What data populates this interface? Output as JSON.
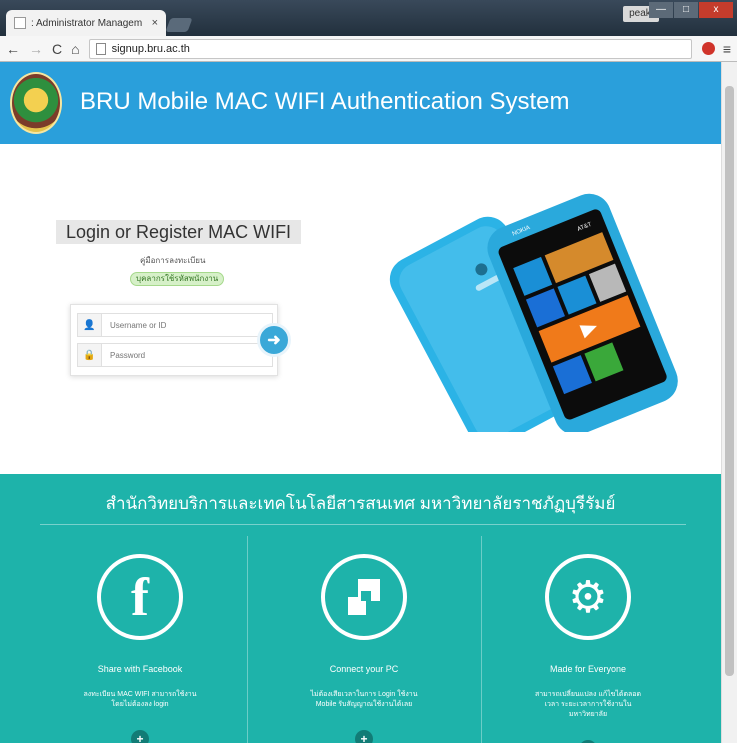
{
  "browser": {
    "tab_title": ": Administrator Managem",
    "tab_close": "×",
    "user_badge": "peakj",
    "win_min": "—",
    "win_max": "□",
    "win_close": "x",
    "back": "←",
    "forward": "→",
    "reload": "C",
    "home": "⌂",
    "url": "signup.bru.ac.th",
    "menu": "≡"
  },
  "header": {
    "title": "BRU Mobile MAC WIFI Authentication System"
  },
  "login": {
    "heading": "Login or Register MAC WIFI",
    "manual_link": "คู่มือการลงทะเบียน",
    "staff_badge": "บุคลากรใช้รหัสพนักงาน",
    "username_placeholder": "Username or ID",
    "password_placeholder": "Password",
    "user_icon": "👤",
    "lock_icon": "🔒",
    "submit_icon": "➜"
  },
  "phone": {
    "brand": "NOKIA",
    "carrier": "AT&T"
  },
  "footer": {
    "title": "สำนักวิทยบริการและเทคโนโลยีสารสนเทศ มหาวิทยาลัยราชภัฏบุรีรัมย์",
    "features": [
      {
        "icon": "facebook-icon",
        "glyph": "f",
        "title": "Share with Facebook",
        "desc": "ลงทะเบียน MAC WIFI สามารถใช้งาน โดยไม่ต้องลง login",
        "plus": "+"
      },
      {
        "icon": "connect-pc-icon",
        "glyph": "",
        "title": "Connect your PC",
        "desc": "ไม่ต้องเสียเวลาในการ Login ใช้งาน Mobile รับสัญญาณใช้งานได้เลย",
        "plus": "+"
      },
      {
        "icon": "gear-icon",
        "glyph": "⚙",
        "title": "Made for Everyone",
        "desc": "สามารถเปลี่ยนแปลง แก้ไขได้ตลอดเวลา ระยะเวลาการใช้งานในมหาวิทยาลัย",
        "plus": "+"
      }
    ]
  },
  "colors": {
    "header": "#2a9fdb",
    "footer": "#1eb3aa",
    "phone": "#2bb3e6"
  }
}
